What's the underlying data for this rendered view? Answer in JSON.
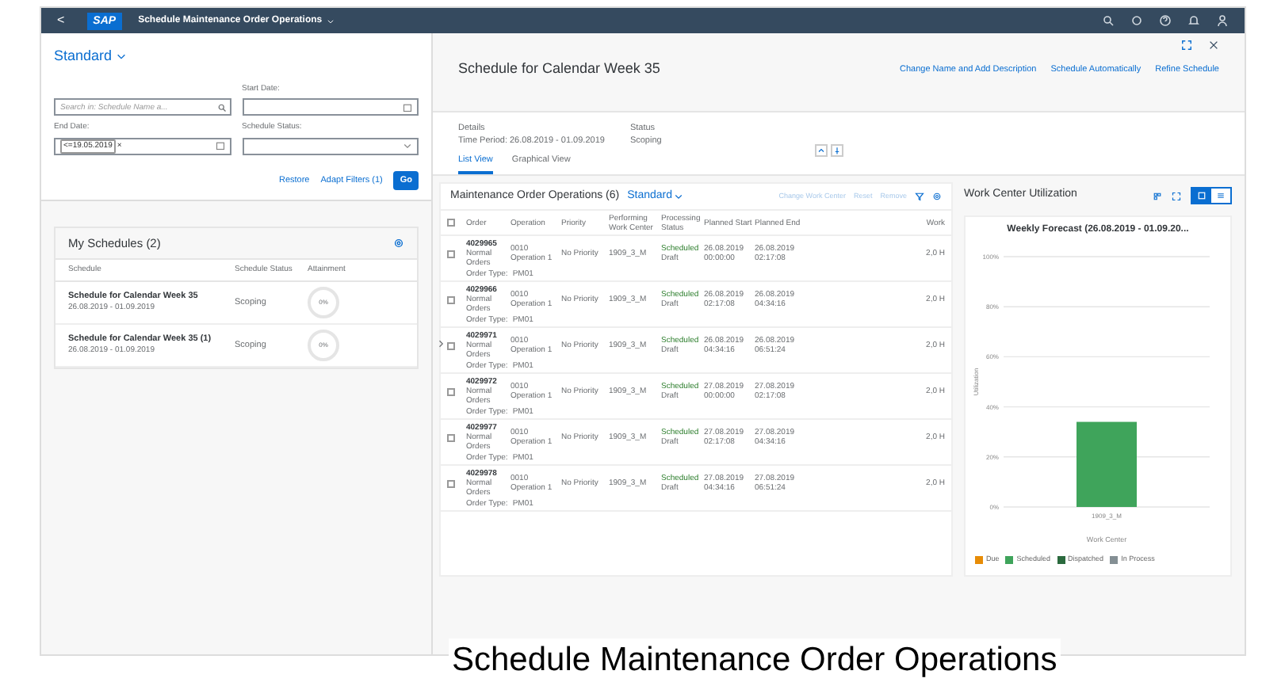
{
  "shell": {
    "back": "<",
    "logo": "SAP",
    "title": "Schedule Maintenance Order Operations"
  },
  "filter_bar": {
    "variant": "Standard",
    "search": {
      "placeholder": "Search in: Schedule Name a..."
    },
    "start_date": {
      "label": "Start Date:"
    },
    "end_date": {
      "label": "End Date:",
      "token": "<=19.05.2019",
      "token_remove": "×"
    },
    "schedule_status": {
      "label": "Schedule Status:"
    },
    "buttons": [
      "Restore",
      "Adapt Filters (1)",
      "Go"
    ]
  },
  "my_schedules": {
    "title": "My Schedules (2)",
    "columns": [
      "Schedule",
      "Schedule Status",
      "Attainment"
    ],
    "rows": [
      {
        "name": "Schedule for Calendar Week 35",
        "period": "26.08.2019 - 01.09.2019",
        "status": "Scoping",
        "attainment": "0%"
      },
      {
        "name": "Schedule for Calendar Week 35 (1)",
        "period": "26.08.2019 - 01.09.2019",
        "status": "Scoping",
        "attainment": "0%"
      }
    ]
  },
  "header": {
    "title": "Schedule for Calendar Week 35",
    "actions": [
      "Change Name and Add Description",
      "Schedule Automatically",
      "Refine Schedule"
    ],
    "details_label": "Details",
    "details_value": "Time Period: 26.08.2019 - 01.09.2019",
    "status_label": "Status",
    "status_value": "Scoping"
  },
  "tabs": [
    {
      "label": "List View",
      "selected": true
    },
    {
      "label": "Graphical View",
      "selected": false
    }
  ],
  "table": {
    "title": "Maintenance Order Operations (6)",
    "variant": "Standard",
    "actions": [
      {
        "label": "Change Work Center",
        "disabled": true
      },
      {
        "label": "Reset",
        "disabled": true
      },
      {
        "label": "Remove",
        "disabled": true
      }
    ],
    "columns": [
      "Order",
      "Operation",
      "Priority",
      "Performing Work Center",
      "Processing Status",
      "Planned Start",
      "Planned End",
      "Work"
    ],
    "header_checkbox": {
      "checked": false
    },
    "rows": [
      {
        "order": "4029965",
        "order_kind": "Normal Orders",
        "op": "0010",
        "op_name": "Operation 1",
        "priority": "No Priority",
        "work_center": "1909_3_M",
        "status": "Scheduled",
        "status_sub": "Draft",
        "start_date": "26.08.2019",
        "start_time": "00:00:00",
        "end_date": "26.08.2019",
        "end_time": "02:17:08",
        "work": "2,0 H",
        "order_type_label": "Order Type:",
        "order_type": "PM01",
        "checked": false
      },
      {
        "order": "4029966",
        "order_kind": "Normal Orders",
        "op": "0010",
        "op_name": "Operation 1",
        "priority": "No Priority",
        "work_center": "1909_3_M",
        "status": "Scheduled",
        "status_sub": "Draft",
        "start_date": "26.08.2019",
        "start_time": "02:17:08",
        "end_date": "26.08.2019",
        "end_time": "04:34:16",
        "work": "2,0 H",
        "order_type_label": "Order Type:",
        "order_type": "PM01",
        "checked": false
      },
      {
        "order": "4029971",
        "order_kind": "Normal Orders",
        "op": "0010",
        "op_name": "Operation 1",
        "priority": "No Priority",
        "work_center": "1909_3_M",
        "status": "Scheduled",
        "status_sub": "Draft",
        "start_date": "26.08.2019",
        "start_time": "04:34:16",
        "end_date": "26.08.2019",
        "end_time": "06:51:24",
        "work": "2,0 H",
        "order_type_label": "Order Type:",
        "order_type": "PM01",
        "checked": false
      },
      {
        "order": "4029972",
        "order_kind": "Normal Orders",
        "op": "0010",
        "op_name": "Operation 1",
        "priority": "No Priority",
        "work_center": "1909_3_M",
        "status": "Scheduled",
        "status_sub": "Draft",
        "start_date": "27.08.2019",
        "start_time": "00:00:00",
        "end_date": "27.08.2019",
        "end_time": "02:17:08",
        "work": "2,0 H",
        "order_type_label": "Order Type:",
        "order_type": "PM01",
        "checked": false
      },
      {
        "order": "4029977",
        "order_kind": "Normal Orders",
        "op": "0010",
        "op_name": "Operation 1",
        "priority": "No Priority",
        "work_center": "1909_3_M",
        "status": "Scheduled",
        "status_sub": "Draft",
        "start_date": "27.08.2019",
        "start_time": "02:17:08",
        "end_date": "27.08.2019",
        "end_time": "04:34:16",
        "work": "2,0 H",
        "order_type_label": "Order Type:",
        "order_type": "PM01",
        "checked": false
      },
      {
        "order": "4029978",
        "order_kind": "Normal Orders",
        "op": "0010",
        "op_name": "Operation 1",
        "priority": "No Priority",
        "work_center": "1909_3_M",
        "status": "Scheduled",
        "status_sub": "Draft",
        "start_date": "27.08.2019",
        "start_time": "04:34:16",
        "end_date": "27.08.2019",
        "end_time": "06:51:24",
        "work": "2,0 H",
        "order_type_label": "Order Type:",
        "order_type": "PM01",
        "checked": false
      }
    ]
  },
  "utilization": {
    "title": "Work Center Utilization",
    "chart_data": {
      "type": "bar",
      "title": "Weekly Forecast (26.08.2019 - 01.09.20...",
      "xlabel": "Work Center",
      "ylabel": "Utilization",
      "categories": [
        "1909_3_M"
      ],
      "stacked": true,
      "series": [
        {
          "name": "Due",
          "color": "#e78c07",
          "values": [
            0
          ]
        },
        {
          "name": "Scheduled",
          "color": "#3fa45b",
          "values": [
            34
          ]
        },
        {
          "name": "Dispatched",
          "color": "#2b6a3e",
          "values": [
            0
          ]
        },
        {
          "name": "In Process",
          "color": "#848f94",
          "values": [
            0
          ]
        }
      ],
      "grid": true,
      "ylim": [
        0,
        100
      ],
      "yticks": [
        {
          "value": 0,
          "label": "0%"
        },
        {
          "value": 20,
          "label": "20%"
        },
        {
          "value": 40,
          "label": "40%"
        },
        {
          "value": 60,
          "label": "60%"
        },
        {
          "value": 80,
          "label": "80%"
        },
        {
          "value": 100,
          "label": "100%"
        }
      ]
    }
  },
  "caption": "Schedule Maintenance Order Operations"
}
